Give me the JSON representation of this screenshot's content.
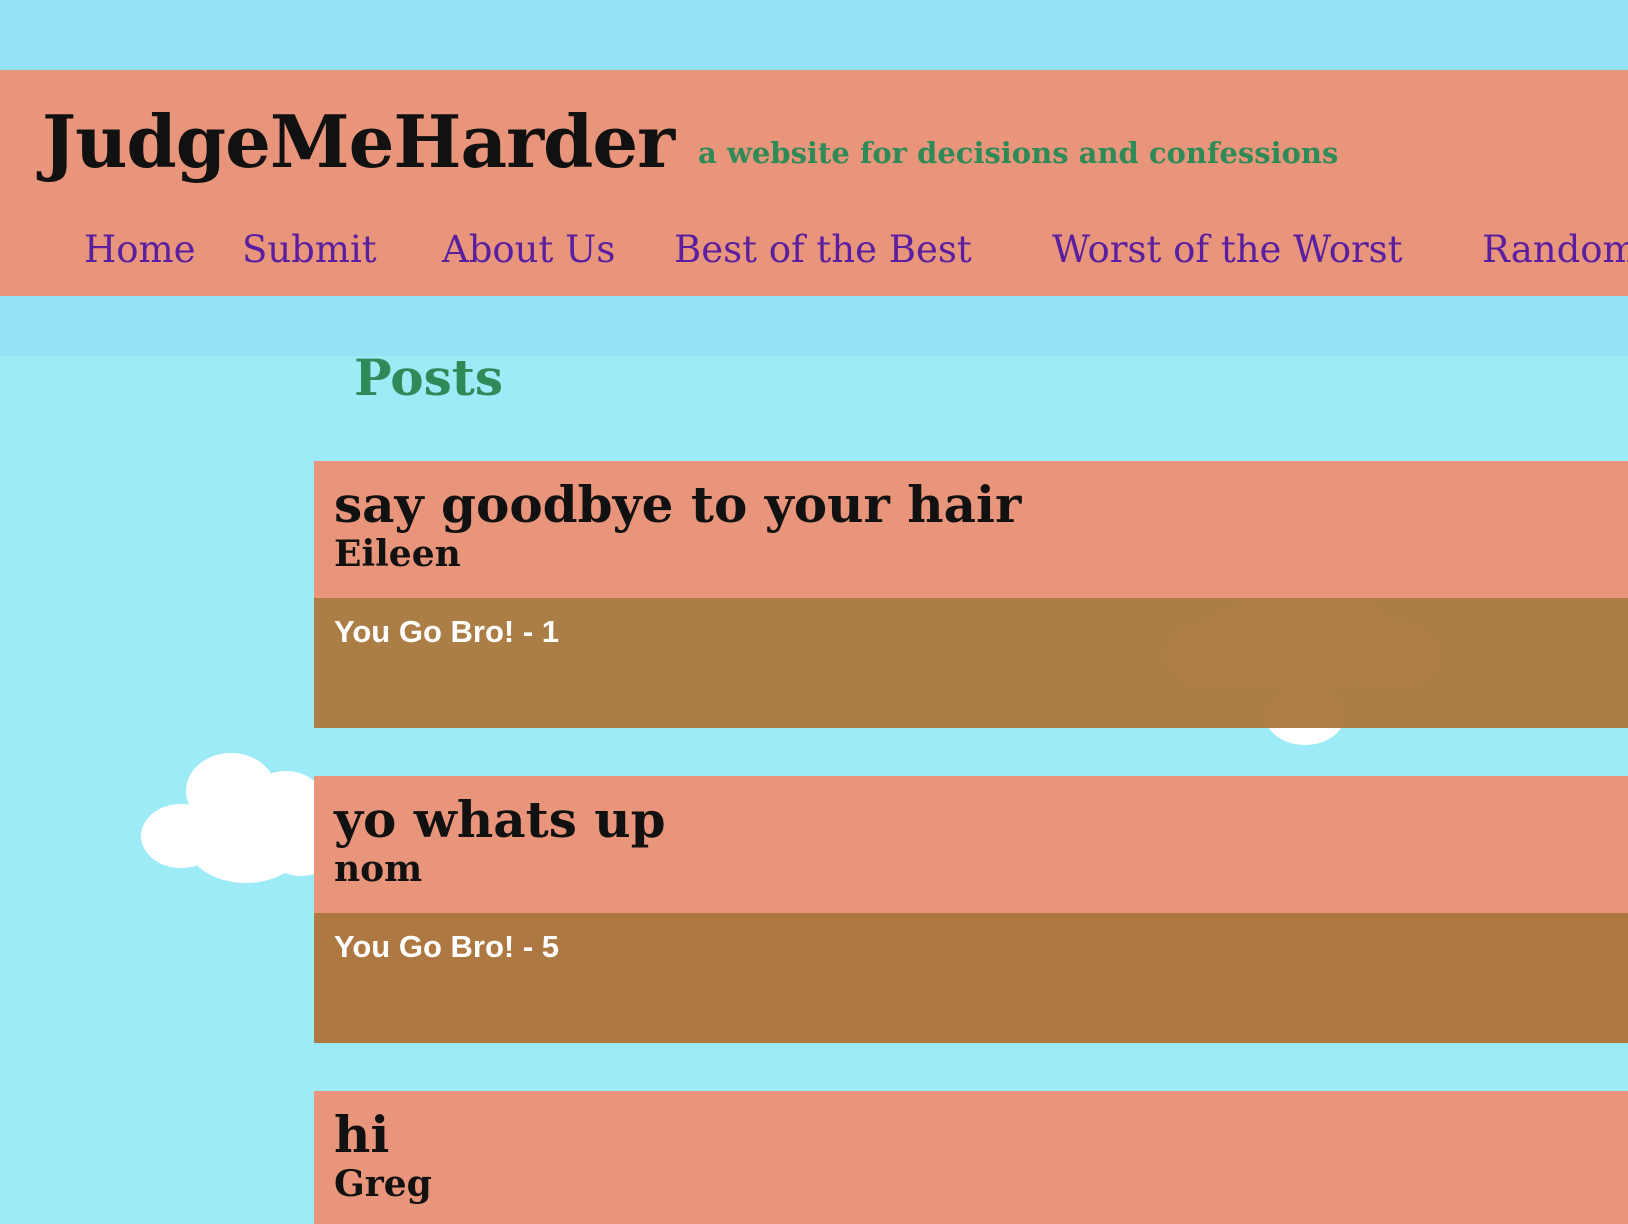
{
  "site": {
    "title": "JudgeMeHarder",
    "tagline": "a website for decisions and confessions"
  },
  "nav": {
    "items": [
      {
        "label": "Home"
      },
      {
        "label": "Submit"
      },
      {
        "label": "About Us"
      },
      {
        "label": "Best of the Best"
      },
      {
        "label": "Worst of the Worst"
      },
      {
        "label": "Random"
      }
    ]
  },
  "main": {
    "heading": "Posts",
    "posts": [
      {
        "title": "say goodbye to your hair",
        "author": "Eileen",
        "vote_label": "You Go Bro! - 1"
      },
      {
        "title": "yo whats up",
        "author": "nom",
        "vote_label": "You Go Bro! - 5"
      },
      {
        "title": "hi",
        "author": "Greg"
      }
    ]
  },
  "colors": {
    "sky": "#9eebf8",
    "header": "#e8957b",
    "title_text": "#111111",
    "tagline_text": "#2e8b57",
    "nav_text": "#5a1fa0",
    "vote_bar": "#ab7a40",
    "cloud": "#ffffff"
  }
}
